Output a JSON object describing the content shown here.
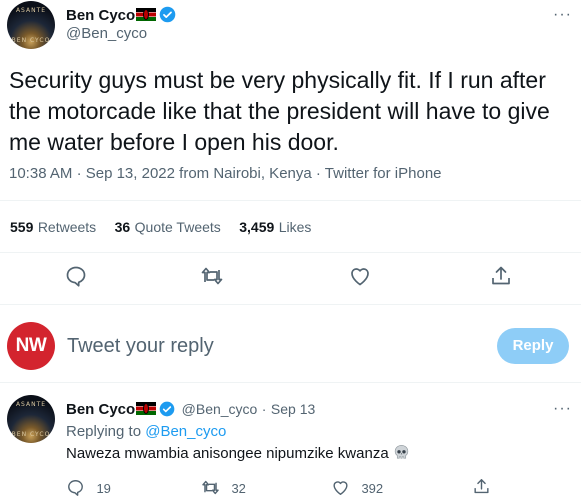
{
  "tweet": {
    "author_name": "Ben Cyco",
    "author_handle": "@Ben_cyco",
    "text": "Security guys must be very physically fit. If I run after the motorcade like that the president will have to give me water before I open his door.",
    "time": "10:38 AM",
    "date": "Sep 13, 2022",
    "location_prefix": "from",
    "location": "Nairobi, Kenya",
    "source": "Twitter for iPhone",
    "separator": "·",
    "more_glyph": "···",
    "retweets_count": "559",
    "retweets_label": "Retweets",
    "quote_count": "36",
    "quote_label": "Quote Tweets",
    "likes_count": "3,459",
    "likes_label": "Likes"
  },
  "reply_box": {
    "logo_text": "NW",
    "placeholder": "Tweet your reply",
    "button_label": "Reply"
  },
  "reply": {
    "author_name": "Ben Cyco",
    "author_handle": "@Ben_cyco",
    "separator": "·",
    "date": "Sep 13",
    "replying_to_label": "Replying to",
    "replying_to_handle": "@Ben_cyco",
    "text": "Naweza mwambia anisongee nipumzike kwanza",
    "reply_count": "19",
    "retweet_count": "32",
    "like_count": "392",
    "more_glyph": "···"
  },
  "colors": {
    "accent": "#1d9bf0",
    "secondary_text": "#536471",
    "reply_button": "#8ecdf7",
    "nw_logo": "#d3242e"
  },
  "icons": [
    "verified-icon",
    "kenya-flag-icon",
    "more-icon",
    "reply-icon",
    "retweet-icon",
    "like-icon",
    "share-icon",
    "skull-emoji-icon"
  ]
}
